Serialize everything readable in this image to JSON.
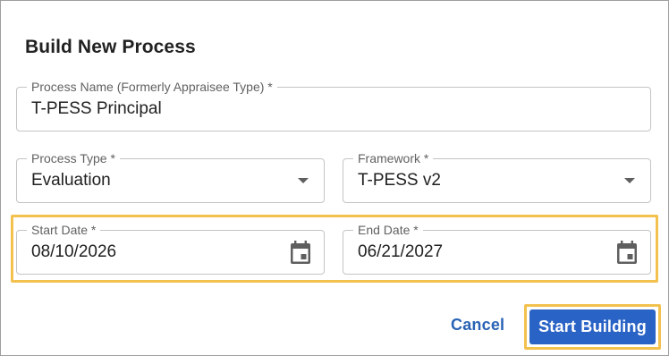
{
  "dialog": {
    "title": "Build New Process"
  },
  "fields": {
    "process_name": {
      "label": "Process Name (Formerly Appraisee Type) *",
      "value": "T-PESS Principal"
    },
    "process_type": {
      "label": "Process Type *",
      "value": "Evaluation",
      "icon": "chevron-down-icon"
    },
    "framework": {
      "label": "Framework *",
      "value": "T-PESS v2",
      "icon": "chevron-down-icon"
    },
    "start_date": {
      "label": "Start Date *",
      "value": "08/10/2026",
      "icon": "calendar-icon"
    },
    "end_date": {
      "label": "End Date *",
      "value": "06/21/2027",
      "icon": "calendar-icon"
    }
  },
  "actions": {
    "cancel_label": "Cancel",
    "start_label": "Start Building"
  },
  "colors": {
    "primary": "#2a63c6",
    "link": "#2a63b5",
    "highlight": "#f2c14e",
    "field_border": "#c4c4c4",
    "icon": "#5f5f5f"
  }
}
